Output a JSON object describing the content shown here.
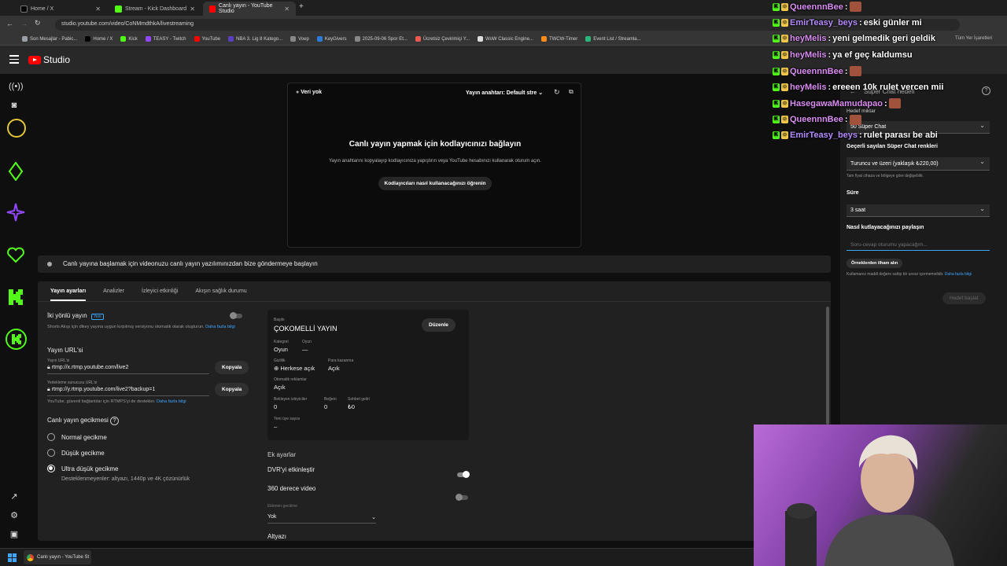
{
  "browser": {
    "tabs": [
      {
        "label": "Home / X",
        "active": false,
        "color": "#000000"
      },
      {
        "label": "Stream - Kick Dashboard",
        "active": false,
        "color": "#53fc18"
      },
      {
        "label": "Canlı yayın - YouTube Studio",
        "active": true,
        "color": "#ff0000"
      }
    ],
    "new_tab": "+",
    "url": "studio.youtube.com/video/CoNMmdthkA/livestreaming",
    "bookmarks": [
      "Son Mesajlar - Pabic...",
      "Home / X",
      "Kick",
      "TEASY - Twitch",
      "YouTube",
      "NBA 3. Lig 8 Katego...",
      "Voep",
      "KeyGivers",
      "2025-09-06 Spor Et...",
      "Ücretsiz Çevirimiçi Y...",
      "WoW Classic Engine...",
      "TWCW-Timer",
      "Event List / Streamla..."
    ],
    "bookmarks_right": "Tüm Yer İşaretleri"
  },
  "studio": {
    "logo_text": "Studio"
  },
  "preview": {
    "status": "Veri yok",
    "stream_key": "Yayın anahtarı: Default stre",
    "title": "Canlı yayın yapmak için kodlayıcınızı bağlayın",
    "subtitle": "Yayın anahtarını kopyalayıp kodlayıcınıza yapıştırın veya YouTube hesabınızı kullanarak oturum açın.",
    "button": "Kodlayıcıları nasıl kullanacağınızı öğrenin"
  },
  "notice": "Canlı yayına başlamak için videonuzu canlı yayın yazılımınızdan bize göndermeye başlayın",
  "settings": {
    "tabs": [
      "Yayın ayarları",
      "Analizler",
      "İzleyici etkinliği",
      "Akışın sağlık durumu"
    ],
    "two_way": {
      "label": "İki yönlü yayın",
      "badge": "Yeni",
      "desc": "Shorts Akışı için dikey yayına uygun kırpılmış versiyonu otomatik olarak oluşturun.",
      "more": "Daha fazla bilgi"
    },
    "url_section": "Yayın URL'si",
    "url_label": "Yayın URL'si",
    "url_value": "rtmp://x.rtmp.youtube.com/live2",
    "backup_label": "Yedekleme sunucusu URL'si",
    "backup_value": "rtmp://y.rtmp.youtube.com/live2?backup=1",
    "copy": "Kopyala",
    "rtmps_note": "YouTube, güvenli bağlantılar için RTMPS'yi de destekler.",
    "rtmps_more": "Daha fazla bilgi",
    "latency_title": "Canlı yayın gecikmesi",
    "latency_options": [
      "Normal gecikme",
      "Düşük gecikme",
      "Ultra düşük gecikme"
    ],
    "ultra_note": "Desteklenmeyenler: altyazı, 1440p ve 4K çözünürlük"
  },
  "card": {
    "title_key": "Başlık",
    "title_value": "ÇOKOMELLİ YAYIN",
    "edit": "Düzenle",
    "category_key": "Kategori",
    "category_value": "Oyun",
    "game_key": "Oyun",
    "game_value": "—",
    "privacy_key": "Gizlilik",
    "privacy_value": "Herkese açık",
    "monet_key": "Para kazanma",
    "monet_value": "Açık",
    "ads_key": "Otomatik reklamlar",
    "ads_value": "Açık",
    "viewers_key": "Bekleyen izleyiciler",
    "viewers_value": "0",
    "likes_key": "Beğeni",
    "likes_value": "0",
    "chat_key": "Sohbet geliri",
    "chat_value": "₺0",
    "members_key": "Yeni üye sayısı",
    "members_value": "–"
  },
  "extra": {
    "title": "Ek ayarlar",
    "dvr": "DVR'yi etkinleştir",
    "vr360": "360 derece video",
    "delay_label": "Eklenen gecikme",
    "delay_value": "Yok",
    "subtitles": "Altyazı"
  },
  "rpanel": {
    "header": "Süper Chat hedefi",
    "target_label": "Hedef miktar",
    "target_value": "50 Süper Chat",
    "colors_label": "Geçerli sayılan Süper Chat renkleri",
    "colors_value": "Turuncu ve üzeri (yaklaşık ₺220,00)",
    "colors_note": "Tam fiyat cihaza ve bölgeye göre değişebilir.",
    "duration_label": "Süre",
    "duration_value": "3 saat",
    "share_label": "Nasıl kutlayacağınızı paylaşın",
    "share_placeholder": "Soru-cevap oturumu yapacağım...",
    "inspire": "Örneklerden ilham alın",
    "policy": "Kutlamanız maddi değere sahip bir unsur içermemelidir.",
    "policy_more": "Daha fazla bilgi",
    "start": "Hedef başlat"
  },
  "chat": [
    {
      "user": "QueennnBee",
      "msg": "",
      "color": "#d98cf2",
      "emote": true
    },
    {
      "user": "EmirTeasy_beys",
      "msg": "eski günler mi",
      "color": "#b58bff",
      "emote": false
    },
    {
      "user": "heyMelis",
      "msg": "yeni gelmedik geri geldik",
      "color": "#d98cf2",
      "emote": false
    },
    {
      "user": "heyMelis",
      "msg": "ya ef geç kaldumsu",
      "color": "#d98cf2",
      "emote": false
    },
    {
      "user": "QueennnBee",
      "msg": "",
      "color": "#d98cf2",
      "emote": true
    },
    {
      "user": "heyMelis",
      "msg": "ereeen 10k rulet vercen mii",
      "color": "#d98cf2",
      "emote": false
    },
    {
      "user": "HasegawaMamudapao",
      "msg": "",
      "color": "#d98cf2",
      "emote": true
    },
    {
      "user": "QueennnBee",
      "msg": "",
      "color": "#d98cf2",
      "emote": true
    },
    {
      "user": "EmirTeasy_beys",
      "msg": "rulet parası be abi",
      "color": "#b58bff",
      "emote": false
    }
  ],
  "taskbar": {
    "window": "Canlı yayın - YouTube St"
  }
}
